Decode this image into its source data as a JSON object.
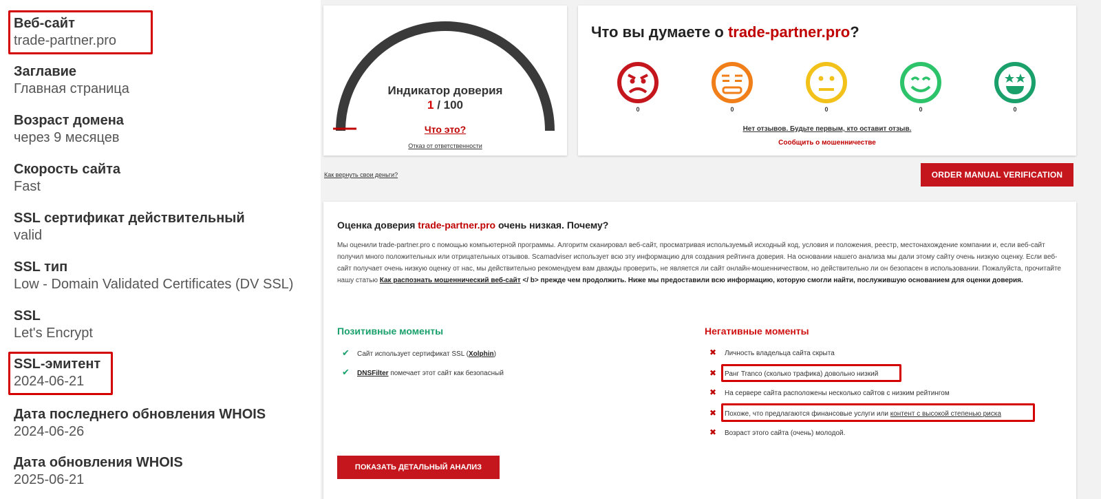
{
  "sidebar": {
    "items": [
      {
        "label": "Веб-сайт",
        "value": "trade-partner.pro"
      },
      {
        "label": "Заглавие",
        "value": "Главная страница"
      },
      {
        "label": "Возраст домена",
        "value": "через 9 месяцев"
      },
      {
        "label": "Скорость сайта",
        "value": "Fast"
      },
      {
        "label": "SSL сертификат действительный",
        "value": "valid"
      },
      {
        "label": "SSL тип",
        "value": "Low - Domain Validated Certificates (DV SSL)"
      },
      {
        "label": "SSL",
        "value": "Let's Encrypt"
      },
      {
        "label": "SSL-эмитент",
        "value": "2024-06-21"
      },
      {
        "label": "Дата последнего обновления WHOIS",
        "value": "2024-06-26"
      },
      {
        "label": "Дата обновления WHOIS",
        "value": "2025-06-21"
      }
    ]
  },
  "gauge": {
    "title": "Индикатор доверия",
    "score": "1",
    "score_max": "/ 100",
    "score_value": 1,
    "what_link": "Что это?",
    "disclaimer": "Отказ от ответственности",
    "track_color": "#3a3a3a",
    "needle_color": "#c00000"
  },
  "reviews": {
    "title_prefix": "Что вы думаете о ",
    "site": "trade-partner.pro",
    "title_suffix": "?",
    "faces": [
      {
        "icon": "angry-face-icon",
        "count": "0",
        "color": "#c4161c"
      },
      {
        "icon": "unamused-face-icon",
        "count": "0",
        "color": "#f07f1a"
      },
      {
        "icon": "neutral-face-icon",
        "count": "0",
        "color": "#f2c21b"
      },
      {
        "icon": "smiling-face-icon",
        "count": "0",
        "color": "#2cc36b"
      },
      {
        "icon": "star-eyes-face-icon",
        "count": "0",
        "color": "#1aa06b"
      }
    ],
    "no_reviews": "Нет отзывов. Будьте первым, кто оставит отзыв.",
    "report": "Сообщить о мошенничестве"
  },
  "links": {
    "get_money_back": "Как вернуть свои деньги?",
    "order_button": "ORDER MANUAL VERIFICATION"
  },
  "analysis": {
    "title_prefix": "Оценка доверия ",
    "site": "trade-partner.pro",
    "title_suffix": " очень низкая. Почему?",
    "body_1": "Мы оценили trade-partner.pro с помощью компьютерной программы. Алгоритм сканировал веб-сайт, просматривая используемый исходный код, условия и положения, реестр, местонахождение компании и, если веб-сайт получил много положительных или отрицательных отзывов. Scamadviser использует всю эту информацию для создания рейтинга доверия. На основании нашего анализа мы дали этому сайту очень низкую оценку. Если веб-сайт получает очень низкую оценку от нас, мы действительно рекомендуем вам дважды проверить, не является ли сайт онлайн-мошенничеством, но действительно ли он безопасен в использовании. Пожалуйста, прочитайте нашу статью ",
    "body_link": "Как распознать мошеннический веб-сайт",
    "body_2": " </ b> прежде чем продолжить. Ниже мы предоставили всю информацию, которую смогли найти, послужившую основанием для оценки доверия.",
    "positive_heading": "Позитивные моменты",
    "negative_heading": "Негативные моменты",
    "positives": [
      {
        "prefix": "Сайт использует сертификат SSL (",
        "link": "Xolphin",
        "suffix": ")"
      },
      {
        "prefix": "",
        "link": "DNSFilter",
        "suffix": " помечает этот сайт как безопасный"
      }
    ],
    "negatives": [
      {
        "text": "Личность владельца сайта скрыта",
        "link": ""
      },
      {
        "text": "Ранг Tranco (сколько трафика) довольно низкий",
        "link": ""
      },
      {
        "text": "На сервере сайта расположены несколько сайтов с низким рейтингом",
        "link": ""
      },
      {
        "text": "Похоже, что предлагаются финансовые услуги или ",
        "link": "контент с высокой степенью риска"
      },
      {
        "text": "Возраст этого сайта (очень) молодой.",
        "link": ""
      }
    ],
    "detail_button": "ПОКАЗАТЬ ДЕТАЛЬНЫЙ АНАЛИЗ"
  },
  "colors": {
    "accent_red": "#c4161c",
    "positive_green": "#1aa06b",
    "highlight_red": "#d40000"
  }
}
